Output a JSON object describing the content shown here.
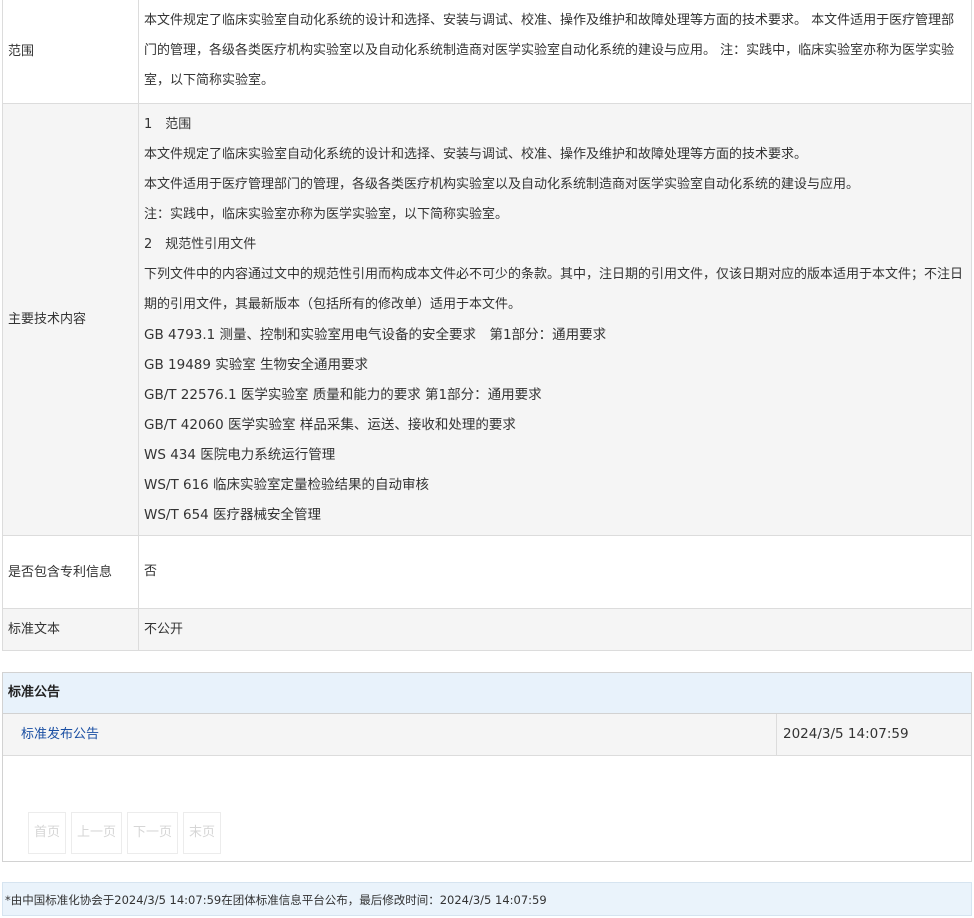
{
  "info": {
    "scope": {
      "label": "范围",
      "value": "本文件规定了临床实验室自动化系统的设计和选择、安装与调试、校准、操作及维护和故障处理等方面的技术要求。 本文件适用于医疗管理部门的管理，各级各类医疗机构实验室以及自动化系统制造商对医学实验室自动化系统的建设与应用。 注：实践中，临床实验室亦称为医学实验室，以下简称实验室。"
    },
    "tech": {
      "label": "主要技术内容",
      "lines": [
        "1　范围",
        "本文件规定了临床实验室自动化系统的设计和选择、安装与调试、校准、操作及维护和故障处理等方面的技术要求。",
        "本文件适用于医疗管理部门的管理，各级各类医疗机构实验室以及自动化系统制造商对医学实验室自动化系统的建设与应用。",
        "注：实践中，临床实验室亦称为医学实验室，以下简称实验室。",
        "2　规范性引用文件",
        "下列文件中的内容通过文中的规范性引用而构成本文件必不可少的条款。其中，注日期的引用文件，仅该日期对应的版本适用于本文件；不注日期的引用文件，其最新版本（包括所有的修改单）适用于本文件。",
        "GB 4793.1  测量、控制和实验室用电气设备的安全要求　第1部分：通用要求",
        "GB 19489  实验室 生物安全通用要求",
        "GB/T 22576.1  医学实验室 质量和能力的要求  第1部分：通用要求",
        "GB/T 42060  医学实验室 样品采集、运送、接收和处理的要求",
        "WS 434  医院电力系统运行管理",
        "WS/T 616  临床实验室定量检验结果的自动审核",
        "WS/T 654  医疗器械安全管理"
      ]
    },
    "patent": {
      "label": "是否包含专利信息",
      "value": "否"
    },
    "text": {
      "label": "标准文本",
      "value": "不公开"
    }
  },
  "notice": {
    "title": "标准公告",
    "items": [
      {
        "title": "标准发布公告",
        "date": "2024/3/5 14:07:59"
      }
    ],
    "pager": {
      "first": "首页",
      "prev": "上一页",
      "next": "下一页",
      "last": "末页"
    }
  },
  "footer": {
    "text": "*由中国标准化协会于2024/3/5 14:07:59在团体标准信息平台公布，最后修改时间：2024/3/5 14:07:59"
  }
}
